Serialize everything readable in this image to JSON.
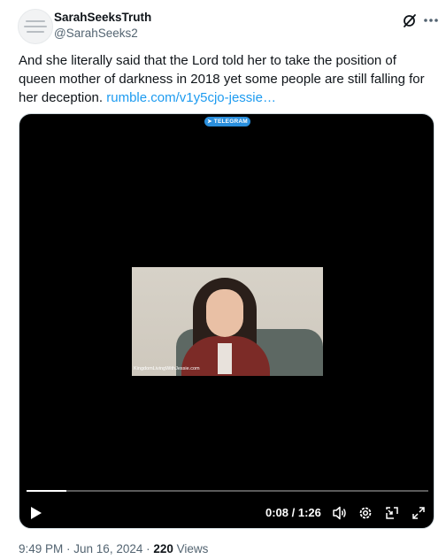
{
  "author": {
    "display_name": "SarahSeeksTruth",
    "handle": "@SarahSeeks2"
  },
  "tweet": {
    "text": "And she literally said that the Lord told her to take the position of queen mother of darkness in 2018 yet some people are still falling for her deception. ",
    "link_text": "rumble.com/v1y5cjo-jessie…"
  },
  "video": {
    "badge": "TELEGRAM",
    "watermark": "KingdomLivingWithJessie.com",
    "time_display": "0:08 / 1:26",
    "progress": 0.1
  },
  "meta": {
    "time": "9:49 PM",
    "sep1": " · ",
    "date": "Jun 16, 2024",
    "sep2": " · ",
    "views_count": "220",
    "views_label": " Views"
  },
  "icons": {
    "grok": "grok-icon",
    "more": "more-icon",
    "play": "play-icon",
    "volume": "volume-icon",
    "settings": "settings-icon",
    "pip": "picture-in-picture-icon",
    "fullscreen": "fullscreen-icon"
  },
  "colors": {
    "link": "#1d9bf0",
    "text": "#0f1419",
    "secondary": "#536471",
    "telegram": "#2a8fdd"
  }
}
